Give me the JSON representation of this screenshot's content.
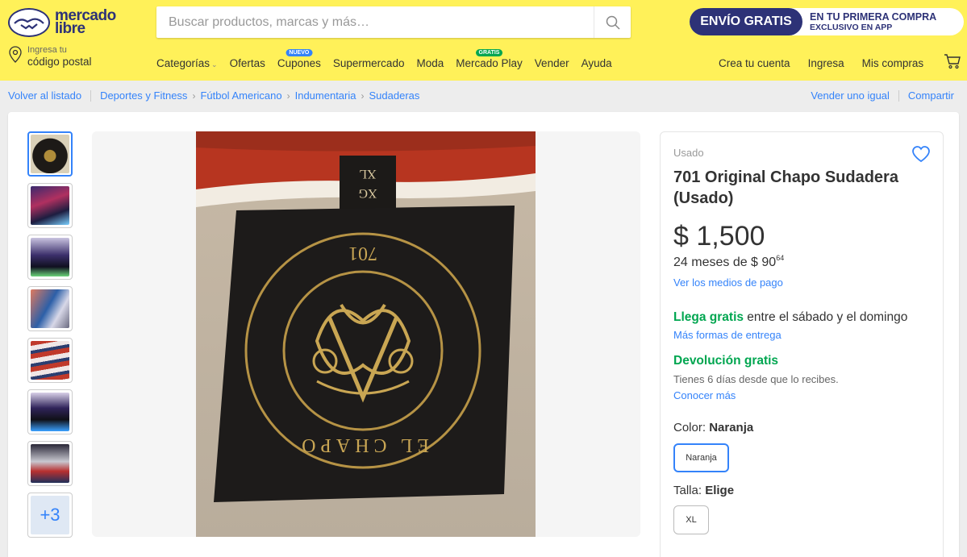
{
  "brand": {
    "name_line1": "mercado",
    "name_line2": "libre"
  },
  "search": {
    "placeholder": "Buscar productos, marcas y más…"
  },
  "promo": {
    "pill": "ENVÍO GRATIS",
    "line1_prefix": "EN TU ",
    "line1_bold": "PRIMERA COMPRA",
    "line2": "EXCLUSIVO EN APP"
  },
  "location": {
    "small": "Ingresa tu",
    "big": "código postal"
  },
  "nav": {
    "categorias": "Categorías",
    "ofertas": "Ofertas",
    "cupones": "Cupones",
    "cupones_tag": "NUEVO",
    "supermercado": "Supermercado",
    "moda": "Moda",
    "mercado_play": "Mercado Play",
    "mercado_play_tag": "GRATIS",
    "vender": "Vender",
    "ayuda": "Ayuda"
  },
  "account": {
    "create": "Crea tu cuenta",
    "login": "Ingresa",
    "purchases": "Mis compras"
  },
  "breadcrumb": {
    "back": "Volver al listado",
    "items": [
      "Deportes y Fitness",
      "Fútbol Americano",
      "Indumentaria",
      "Sudaderas"
    ],
    "sell_same": "Vender uno igual",
    "share": "Compartir"
  },
  "thumbnails": {
    "more": "+3"
  },
  "product": {
    "condition": "Usado",
    "title": "701 Original Chapo Sudadera (Usado)",
    "price": "$ 1,500",
    "installments_prefix": "24 meses de $ 90",
    "installments_cents": "64",
    "payment_link": "Ver los medios de pago",
    "shipping_bold": "Llega gratis",
    "shipping_rest": " entre el sábado y el domingo",
    "shipping_link": "Más formas de entrega",
    "return_title": "Devolución gratis",
    "return_note": "Tienes 6 días desde que lo recibes.",
    "return_link": "Conocer más",
    "color_label": "Color: ",
    "color_value": "Naranja",
    "color_option": "Naranja",
    "size_label": "Talla: ",
    "size_value": "Elige",
    "size_option": "XL"
  },
  "photo": {
    "label_text_1": "XL",
    "label_text_2": "XG",
    "seal_number": "701",
    "seal_text": "EL CHAPO"
  },
  "colors": {
    "header_bg": "#fff159",
    "brand_blue": "#2d3277",
    "link_blue": "#3483fa",
    "green": "#00a650"
  }
}
